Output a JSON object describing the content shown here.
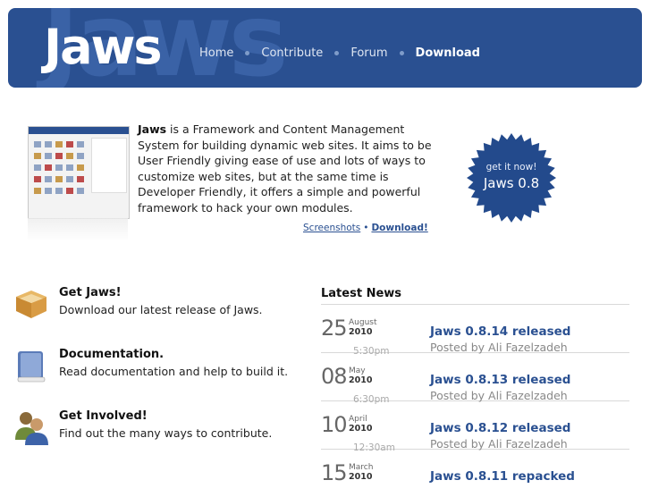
{
  "header": {
    "logo": "Jaws",
    "nav": [
      {
        "label": "Home",
        "active": false
      },
      {
        "label": "Contribute",
        "active": false
      },
      {
        "label": "Forum",
        "active": false
      },
      {
        "label": "Download",
        "active": true
      }
    ]
  },
  "intro": {
    "product": "Jaws",
    "text": " is a Framework and Content Management System for building dynamic web sites. It aims to be User Friendly giving ease of use and lots of ways to customize web sites, but at the same time is Developer Friendly, it offers a simple and powerful framework to hack your own modules.",
    "links": {
      "screenshots": "Screenshots",
      "separator": "•",
      "download": "Download!"
    }
  },
  "badge": {
    "line1": "get it now!",
    "line2": "Jaws 0.8"
  },
  "features": [
    {
      "title": "Get Jaws!",
      "desc": "Download our latest release of Jaws.",
      "icon": "box-icon"
    },
    {
      "title": "Documentation.",
      "desc": "Read documentation and help to build it.",
      "icon": "book-icon"
    },
    {
      "title": "Get Involved!",
      "desc": "Find out the many ways to contribute.",
      "icon": "people-icon"
    }
  ],
  "news": {
    "title": "Latest News",
    "items": [
      {
        "day": "25",
        "month": "August",
        "year": "2010",
        "time": "5:30pm",
        "headline": "Jaws 0.8.14 released",
        "author": "Posted by Ali Fazelzadeh"
      },
      {
        "day": "08",
        "month": "May",
        "year": "2010",
        "time": "6:30pm",
        "headline": "Jaws 0.8.13 released",
        "author": "Posted by Ali Fazelzadeh"
      },
      {
        "day": "10",
        "month": "April",
        "year": "2010",
        "time": "12:30am",
        "headline": "Jaws 0.8.12 released",
        "author": "Posted by Ali Fazelzadeh"
      },
      {
        "day": "15",
        "month": "March",
        "year": "2010",
        "time": "",
        "headline": "Jaws 0.8.11 repacked",
        "author": ""
      }
    ]
  },
  "colors": {
    "brand": "#2a5091",
    "link": "#2a5091"
  }
}
